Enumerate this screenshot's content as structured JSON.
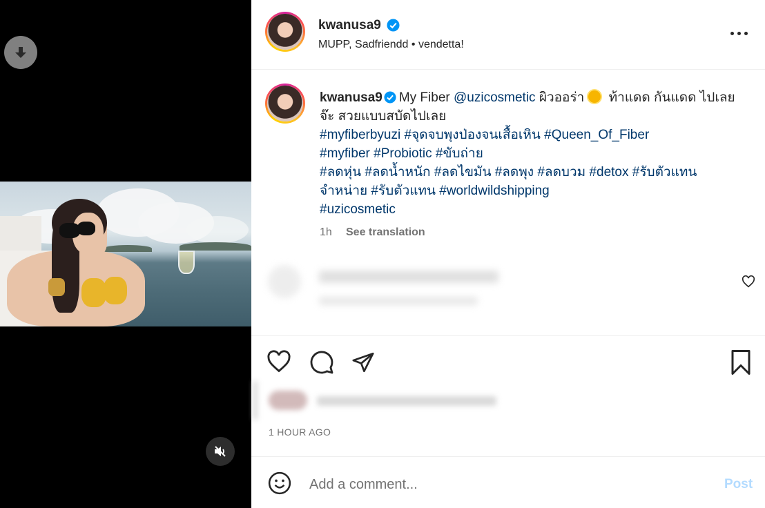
{
  "post": {
    "username": "kwanusa9",
    "subtitle": "MUPP, Sadfriendd • vendetta!",
    "caption": {
      "username": "kwanusa9",
      "text_1": "My Fiber ",
      "mention": "@uzicosmetic",
      "text_2": " ผิวออร่า",
      "text_3": " ท้าแดด กันแดด ไปเลยจ๊ะ สวยแบบสบัดไปเลย",
      "hashtags_1": "#myfiberbyuzi #จุดจบพุงป่องจนเสื้อเหิน #Queen_Of_Fiber",
      "hashtags_2": "#myfiber #Probiotic #ขับถ่าย",
      "hashtags_3": "#ลดหุ่น #ลดน้ำหนัก #ลดไขมัน #ลดพุง #ลดบวม #detox #รับตัวแทนจำหน่าย #รับตัวแทน #worldwildshipping",
      "hashtags_4": "#uzicosmetic",
      "time": "1h",
      "see_translation": "See translation"
    },
    "timestamp": "1 HOUR AGO"
  },
  "comment_box": {
    "placeholder": "Add a comment...",
    "post_label": "Post"
  },
  "colors": {
    "link": "#00376b",
    "verified": "#0095f6",
    "post_disabled": "#b3dbff"
  },
  "icons": [
    "download-icon",
    "mute-icon",
    "verified-icon",
    "more-icon",
    "heart-icon",
    "comment-icon",
    "share-icon",
    "bookmark-icon",
    "emoji-icon"
  ]
}
